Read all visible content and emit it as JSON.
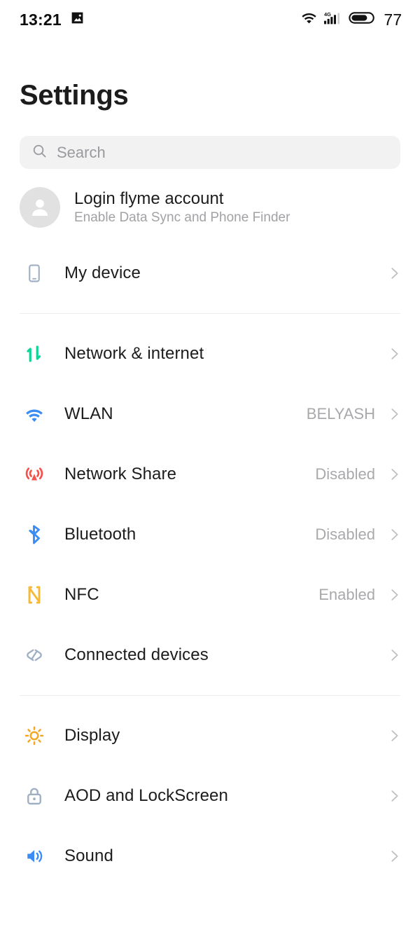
{
  "statusbar": {
    "time": "13:21",
    "image_icon": "image-icon",
    "wifi_icon": "wifi-download-icon",
    "signal_icon": "signal-4g-icon",
    "signal_label": "4G",
    "battery_icon": "battery-icon",
    "battery_level": "77"
  },
  "header": {
    "title": "Settings"
  },
  "search": {
    "icon": "search-icon",
    "placeholder": "Search",
    "value": ""
  },
  "account": {
    "avatar_icon": "person-avatar-icon",
    "title": "Login flyme account",
    "subtitle": "Enable Data Sync and Phone Finder"
  },
  "groups": [
    {
      "name": "device-group",
      "items": [
        {
          "id": "my-device",
          "icon": "phone-icon",
          "label": "My device",
          "value": "",
          "chevron": "chevron-right-icon"
        }
      ]
    },
    {
      "name": "connectivity-group",
      "items": [
        {
          "id": "network-internet",
          "icon": "data-transfer-icon",
          "label": "Network & internet",
          "value": "",
          "chevron": "chevron-right-icon"
        },
        {
          "id": "wlan",
          "icon": "wifi-icon",
          "label": "WLAN",
          "value": "BELYASH",
          "chevron": "chevron-right-icon"
        },
        {
          "id": "network-share",
          "icon": "hotspot-icon",
          "label": "Network Share",
          "value": "Disabled",
          "chevron": "chevron-right-icon"
        },
        {
          "id": "bluetooth",
          "icon": "bluetooth-icon",
          "label": "Bluetooth",
          "value": "Disabled",
          "chevron": "chevron-right-icon"
        },
        {
          "id": "nfc",
          "icon": "nfc-icon",
          "label": "NFC",
          "value": "Enabled",
          "chevron": "chevron-right-icon"
        },
        {
          "id": "connected-devices",
          "icon": "link-icon",
          "label": "Connected devices",
          "value": "",
          "chevron": "chevron-right-icon"
        }
      ]
    },
    {
      "name": "display-sound-group",
      "items": [
        {
          "id": "display",
          "icon": "sun-icon",
          "label": "Display",
          "value": "",
          "chevron": "chevron-right-icon"
        },
        {
          "id": "aod-lockscreen",
          "icon": "lock-icon",
          "label": "AOD and LockScreen",
          "value": "",
          "chevron": "chevron-right-icon"
        },
        {
          "id": "sound",
          "icon": "speaker-icon",
          "label": "Sound",
          "value": "",
          "chevron": "chevron-right-icon"
        }
      ]
    }
  ],
  "colors": {
    "green": "#0ed596",
    "blue": "#3b8cf5",
    "red": "#f4534c",
    "yellow": "#f6ba36",
    "orange": "#f5a623",
    "steel": "#9fb0c4",
    "text": "#1c1c1c",
    "muted": "#a9a9ad",
    "divider": "#ededef",
    "search_bg": "#f2f2f3"
  }
}
